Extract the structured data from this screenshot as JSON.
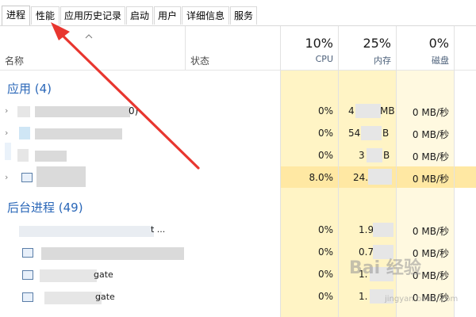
{
  "tabs": [
    "进程",
    "性能",
    "应用历史记录",
    "启动",
    "用户",
    "详细信息",
    "服务"
  ],
  "header": {
    "name_label": "名称",
    "status_label": "状态",
    "cpu": {
      "pct": "10%",
      "label": "CPU"
    },
    "mem": {
      "pct": "25%",
      "label": "内存"
    },
    "disk": {
      "pct": "0%",
      "label": "磁盘"
    }
  },
  "groups": {
    "apps": "应用 (4)",
    "background": "后台进程 (49)"
  },
  "app_rows": [
    {
      "name_tail": "0)",
      "cpu": "0%",
      "mem": "4",
      "mem_unit": "MB",
      "disk": "0 MB/秒"
    },
    {
      "name_tail": "",
      "cpu": "0%",
      "mem": "54",
      "mem_unit": "B",
      "disk": "0 MB/秒"
    },
    {
      "name_tail": "",
      "cpu": "0%",
      "mem": "3",
      "mem_unit": "B",
      "disk": "0 MB/秒"
    },
    {
      "name_tail": "",
      "cpu": "8.0%",
      "mem": "24.",
      "mem_unit": "",
      "disk": "0 MB/秒"
    }
  ],
  "bg_rows": [
    {
      "name_tail": "t ...",
      "cpu": "0%",
      "mem": "1.9",
      "disk": "0 MB/秒"
    },
    {
      "name_tail": "",
      "cpu": "0%",
      "mem": "0.7",
      "disk": "0 MB/秒"
    },
    {
      "name_tail": "gate",
      "cpu": "0%",
      "mem": "1.",
      "disk": "0 MB/秒"
    },
    {
      "name_tail": "gate",
      "cpu": "0%",
      "mem": "1.",
      "disk": "0 MB/秒"
    }
  ],
  "watermark": {
    "main": "Bai 经验",
    "sub": "jingyan.baidu.com"
  },
  "colors": {
    "accent_group": "#2a67b8",
    "heat": "#fff4c5",
    "arrow": "#e8362f"
  }
}
